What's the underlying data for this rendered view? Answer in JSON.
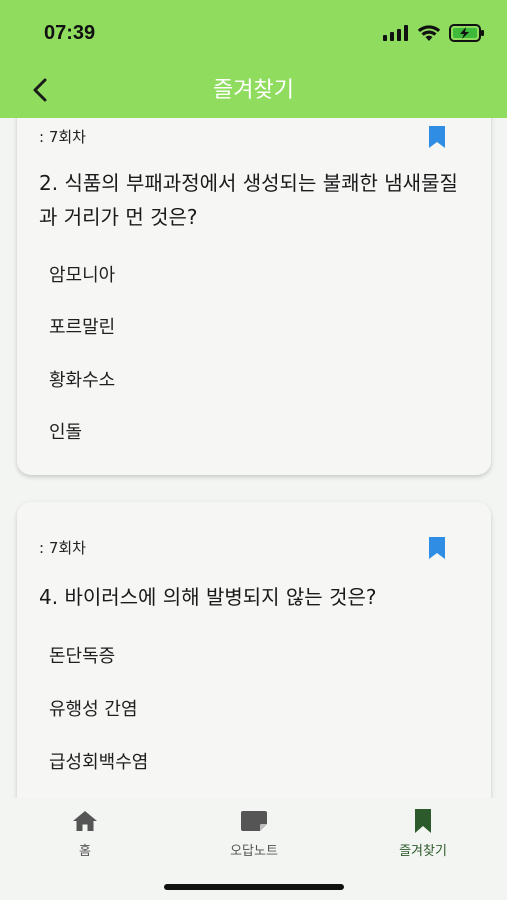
{
  "status": {
    "time": "07:39"
  },
  "appbar": {
    "title": "즐겨찾기"
  },
  "cards": [
    {
      "round": ": 7회차",
      "question": "2. 식품의 부패과정에서 생성되는 불쾌한 냄새물질과 거리가 먼 것은?",
      "options": [
        "암모니아",
        "포르말린",
        "황화수소",
        "인돌"
      ]
    },
    {
      "round": ": 7회차",
      "question": "4. 바이러스에 의해 발병되지 않는 것은?",
      "options": [
        "돈단독증",
        "유행성 간염",
        "급성회백수염"
      ]
    }
  ],
  "nav": {
    "home": "홈",
    "wrong_note": "오답노트",
    "favorites": "즐겨찾기"
  },
  "colors": {
    "header_green": "#8fdc5f",
    "bookmark_blue": "#2f8de4",
    "active_nav": "#2c5a2a",
    "inactive_nav": "#555555"
  }
}
